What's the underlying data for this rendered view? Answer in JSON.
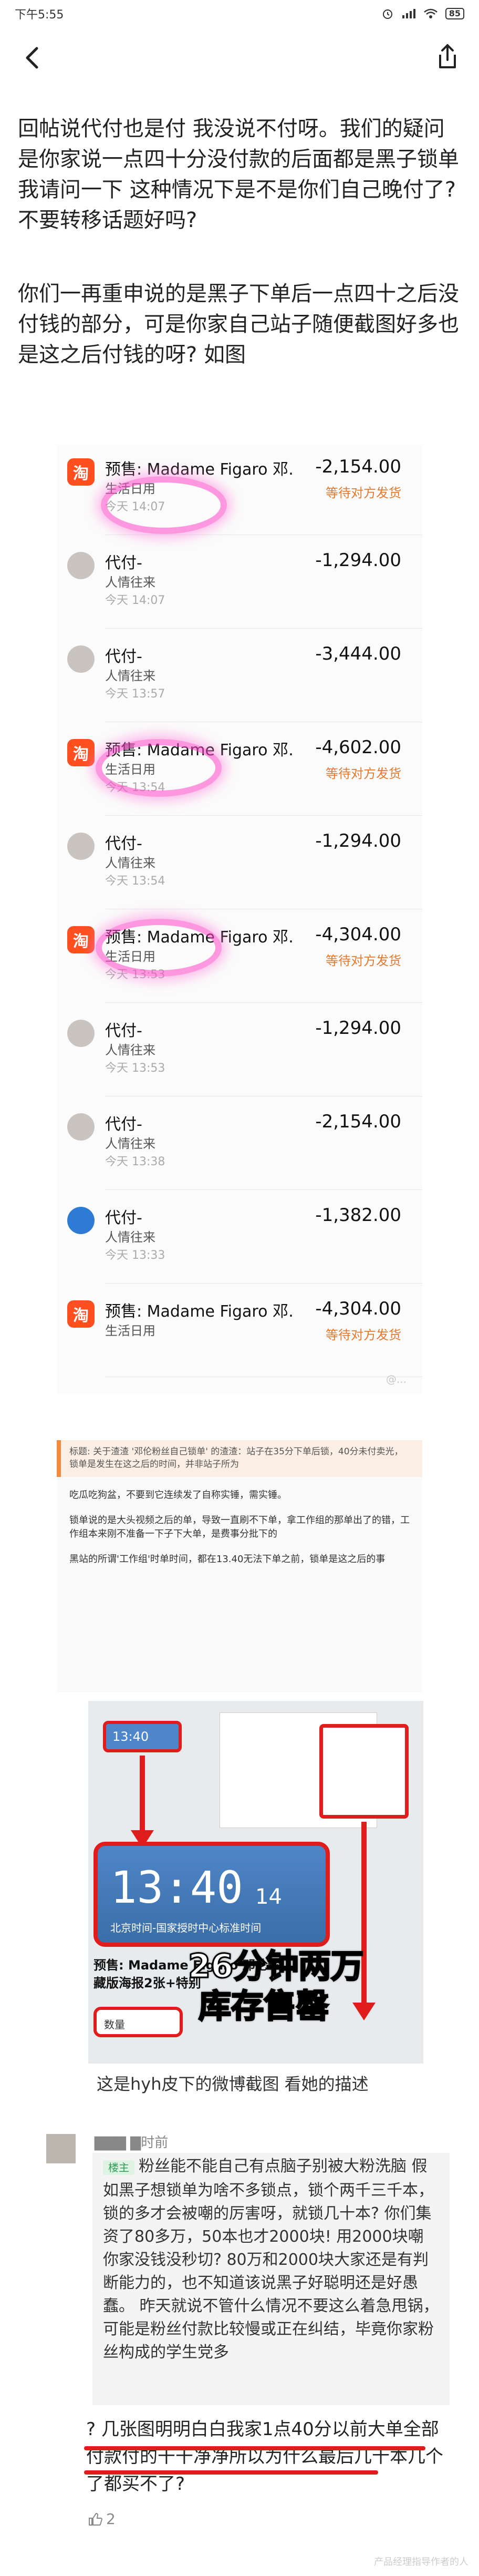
{
  "status_bar": {
    "time": "下午5:55",
    "battery": "85"
  },
  "post": {
    "paragraph1": "回帖说代付也是付 我没说不付呀。我们的疑问是你家说一点四十分没付款的后面都是黑子锁单 我请问一下 这种情况下是不是你们自己晚付了? 不要转移话题好吗?",
    "paragraph2": "你们一再重申说的是黑子下单后一点四十之后没付钱的部分，可是你家自己站子随便截图好多也是这之后付钱的呀? 如图"
  },
  "orders": [
    {
      "kind": "tao",
      "title": "预售: Madame Figaro 邓…",
      "sub": "生活日用",
      "time": "今天 14:07",
      "amount": "-2,154.00",
      "status": "等待对方发货"
    },
    {
      "kind": "person",
      "title": "代付-",
      "sub": "人情往来",
      "time": "今天 14:07",
      "amount": "-1,294.00",
      "status": ""
    },
    {
      "kind": "person",
      "title": "代付-",
      "sub": "人情往来",
      "time": "今天 13:57",
      "amount": "-3,444.00",
      "status": ""
    },
    {
      "kind": "tao",
      "title": "预售: Madame Figaro 邓…",
      "sub": "生活日用",
      "time": "今天 13:54",
      "amount": "-4,602.00",
      "status": "等待对方发货"
    },
    {
      "kind": "person",
      "title": "代付-",
      "sub": "人情往来",
      "time": "今天 13:54",
      "amount": "-1,294.00",
      "status": ""
    },
    {
      "kind": "tao",
      "title": "预售: Madame Figaro 邓…",
      "sub": "生活日用",
      "time": "今天 13:53",
      "amount": "-4,304.00",
      "status": "等待对方发货"
    },
    {
      "kind": "person",
      "title": "代付-",
      "sub": "人情往来",
      "time": "今天 13:53",
      "amount": "-1,294.00",
      "status": ""
    },
    {
      "kind": "person",
      "title": "代付-",
      "sub": "人情往来",
      "time": "今天 13:38",
      "amount": "-2,154.00",
      "status": ""
    },
    {
      "kind": "blue",
      "title": "代付-",
      "sub": "人情往来",
      "time": "今天 13:33",
      "amount": "-1,382.00",
      "status": ""
    },
    {
      "kind": "tao",
      "title": "预售: Madame Figaro 邓…",
      "sub": "生活日用",
      "time": "",
      "amount": "-4,304.00",
      "status": "等待对方发货"
    }
  ],
  "tao_glyph": "淘",
  "shot2": {
    "header": "标题: 关于渣渣 '邓伦粉丝自己锁单' 的渣渣：站子在35分下单后锁，40分未付卖光，锁单是发生在这之后的时间，并非站子所为",
    "line1": "吃瓜吃狗盆，不要到它连续发了自称实锤，需实锤。",
    "line2": "锁单说的是大头视频之后的单，导致一直刷不下单，拿工作组的那单出了的错，工作组本来刚不准备一下子下大单，是费事分批下的",
    "line3": "黑站的所谓'工作组'时单时间，都在13.40无法下单之前，锁单是这之后的事"
  },
  "shot3": {
    "clock_small": "13:40",
    "clock_big": "13:40",
    "clock_seconds": "14",
    "clock_label": "北京时间-国家授时中心标准时间",
    "product": "预售: Madame Figaro 邓伦珍藏版海报2张+特别",
    "qty": "数量",
    "overlay1": "26分钟两万",
    "overlay2": "库存售罄"
  },
  "caption": "这是hyh皮下的微博截图 看她的描述",
  "comment": {
    "name_suffix": "时前",
    "quote_tag": "楼主",
    "quote": "粉丝能不能自己有点脑子别被大粉洗脑 假如黑子想锁单为啥不多锁点，锁个两千三千本，锁的多才会被嘲的厉害呀，就锁几十本? 你们集资了80多万，50本也才2000块! 用2000块嘲你家没钱没秒切? 80万和2000块大家还是有判断能力的，也不知道该说黑子好聪明还是好愚蠢。 昨天就说不管什么情况不要这么着急甩锅，可能是粉丝付款比较慢或正在纠结，毕竟你家粉丝构成的学生党多",
    "reply": "? 几张图明明白白我家1点40分以前大单全部付款付的干干净净所以为什么最后几十本几个了都买不了?",
    "likes": "2"
  },
  "footer": "产品经理指导作者的人"
}
